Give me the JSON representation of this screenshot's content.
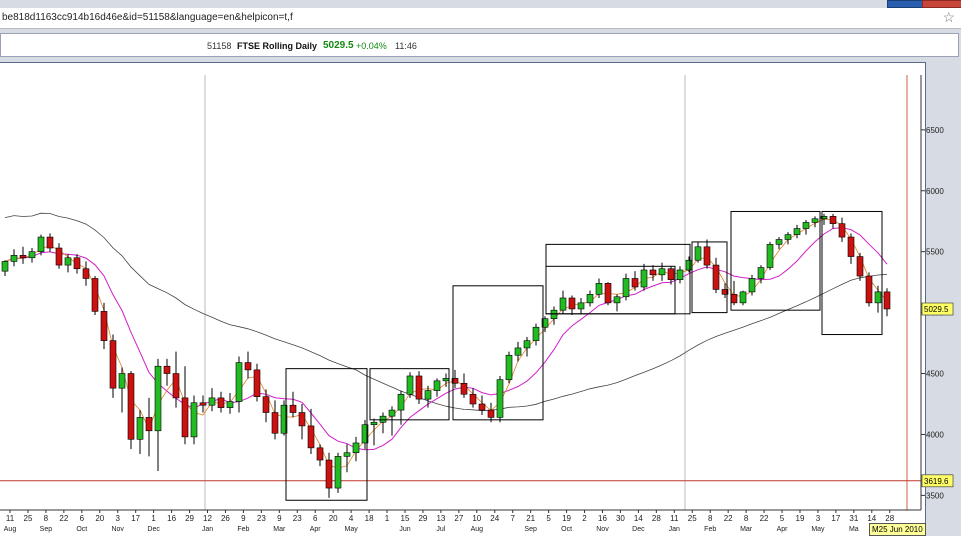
{
  "browser": {
    "url": "be818d1163cc914b16d46e&id=51158&language=en&helpicon=t,f"
  },
  "quote": {
    "id": "51158",
    "name": "FTSE Rolling Daily",
    "price": "5029.5",
    "change": "+0.04%",
    "time": "11:46"
  },
  "chart_data": {
    "type": "candlestick",
    "ylim": [
      3380,
      6950
    ],
    "y_ticks": [
      3500,
      4000,
      4500,
      5000,
      5500,
      6000,
      6500
    ],
    "price_marker": "5029.5",
    "level_marker": "3619.6",
    "reference_level": 3619.6,
    "date_badge": "M25 Jun 2010",
    "x_ticks": [
      {
        "day": "11",
        "month": "Aug"
      },
      {
        "day": "25",
        "month": ""
      },
      {
        "day": "8",
        "month": "Sep"
      },
      {
        "day": "22",
        "month": ""
      },
      {
        "day": "6",
        "month": "Oct"
      },
      {
        "day": "20",
        "month": ""
      },
      {
        "day": "3",
        "month": "Nov"
      },
      {
        "day": "17",
        "month": ""
      },
      {
        "day": "1",
        "month": "Dec"
      },
      {
        "day": "16",
        "month": ""
      },
      {
        "day": "29",
        "month": ""
      },
      {
        "day": "12",
        "month": "Jan"
      },
      {
        "day": "26",
        "month": ""
      },
      {
        "day": "9",
        "month": "Feb"
      },
      {
        "day": "23",
        "month": ""
      },
      {
        "day": "9",
        "month": "Mar"
      },
      {
        "day": "23",
        "month": ""
      },
      {
        "day": "6",
        "month": "Apr"
      },
      {
        "day": "20",
        "month": ""
      },
      {
        "day": "4",
        "month": "May"
      },
      {
        "day": "18",
        "month": ""
      },
      {
        "day": "1",
        "month": ""
      },
      {
        "day": "15",
        "month": "Jun"
      },
      {
        "day": "29",
        "month": ""
      },
      {
        "day": "13",
        "month": "Jul"
      },
      {
        "day": "27",
        "month": ""
      },
      {
        "day": "10",
        "month": "Aug"
      },
      {
        "day": "24",
        "month": ""
      },
      {
        "day": "7",
        "month": ""
      },
      {
        "day": "21",
        "month": "Sep"
      },
      {
        "day": "5",
        "month": ""
      },
      {
        "day": "19",
        "month": "Oct"
      },
      {
        "day": "2",
        "month": ""
      },
      {
        "day": "16",
        "month": "Nov"
      },
      {
        "day": "30",
        "month": ""
      },
      {
        "day": "14",
        "month": "Dec"
      },
      {
        "day": "28",
        "month": ""
      },
      {
        "day": "11",
        "month": "Jan"
      },
      {
        "day": "25",
        "month": ""
      },
      {
        "day": "8",
        "month": "Feb"
      },
      {
        "day": "22",
        "month": ""
      },
      {
        "day": "8",
        "month": "Mar"
      },
      {
        "day": "22",
        "month": ""
      },
      {
        "day": "5",
        "month": "Apr"
      },
      {
        "day": "19",
        "month": ""
      },
      {
        "day": "3",
        "month": "May"
      },
      {
        "day": "17",
        "month": ""
      },
      {
        "day": "31",
        "month": "Ma"
      },
      {
        "day": "14",
        "month": ""
      },
      {
        "day": "28",
        "month": ""
      }
    ],
    "candles": [
      [
        5340,
        5430,
        5300,
        5420
      ],
      [
        5420,
        5520,
        5380,
        5470
      ],
      [
        5470,
        5540,
        5400,
        5450
      ],
      [
        5450,
        5530,
        5410,
        5500
      ],
      [
        5500,
        5640,
        5470,
        5620
      ],
      [
        5620,
        5650,
        5500,
        5530
      ],
      [
        5530,
        5570,
        5360,
        5390
      ],
      [
        5390,
        5480,
        5330,
        5450
      ],
      [
        5450,
        5480,
        5320,
        5360
      ],
      [
        5360,
        5420,
        5220,
        5280
      ],
      [
        5280,
        5300,
        4980,
        5010
      ],
      [
        5010,
        5080,
        4700,
        4770
      ],
      [
        4770,
        4820,
        4300,
        4380
      ],
      [
        4380,
        4550,
        4180,
        4500
      ],
      [
        4500,
        4520,
        3880,
        3960
      ],
      [
        3960,
        4200,
        3840,
        4140
      ],
      [
        4140,
        4300,
        3820,
        4030
      ],
      [
        4030,
        4620,
        3700,
        4560
      ],
      [
        4560,
        4620,
        4400,
        4500
      ],
      [
        4500,
        4680,
        4220,
        4300
      ],
      [
        4300,
        4560,
        3920,
        3980
      ],
      [
        3980,
        4320,
        3920,
        4260
      ],
      [
        4260,
        4320,
        4180,
        4240
      ],
      [
        4240,
        4380,
        4190,
        4300
      ],
      [
        4300,
        4350,
        4180,
        4220
      ],
      [
        4220,
        4340,
        4170,
        4270
      ],
      [
        4270,
        4640,
        4180,
        4590
      ],
      [
        4590,
        4680,
        4460,
        4530
      ],
      [
        4530,
        4580,
        4270,
        4310
      ],
      [
        4310,
        4370,
        4100,
        4180
      ],
      [
        4180,
        4280,
        3960,
        4010
      ],
      [
        4010,
        4280,
        3990,
        4240
      ],
      [
        4240,
        4350,
        4140,
        4180
      ],
      [
        4180,
        4250,
        3960,
        4070
      ],
      [
        4070,
        4210,
        3840,
        3890
      ],
      [
        3890,
        3920,
        3740,
        3790
      ],
      [
        3790,
        3850,
        3480,
        3560
      ],
      [
        3560,
        3850,
        3520,
        3820
      ],
      [
        3820,
        3920,
        3690,
        3850
      ],
      [
        3850,
        3980,
        3780,
        3930
      ],
      [
        3930,
        4120,
        3880,
        4080
      ],
      [
        4080,
        4130,
        3910,
        4100
      ],
      [
        4100,
        4180,
        4010,
        4150
      ],
      [
        4150,
        4230,
        3990,
        4200
      ],
      [
        4200,
        4360,
        4080,
        4330
      ],
      [
        4330,
        4510,
        4300,
        4480
      ],
      [
        4480,
        4520,
        4250,
        4290
      ],
      [
        4290,
        4400,
        4220,
        4360
      ],
      [
        4360,
        4460,
        4310,
        4440
      ],
      [
        4440,
        4500,
        4390,
        4460
      ],
      [
        4460,
        4530,
        4380,
        4420
      ],
      [
        4420,
        4500,
        4300,
        4330
      ],
      [
        4330,
        4380,
        4220,
        4250
      ],
      [
        4250,
        4320,
        4160,
        4200
      ],
      [
        4200,
        4260,
        4100,
        4140
      ],
      [
        4140,
        4480,
        4100,
        4450
      ],
      [
        4450,
        4680,
        4420,
        4650
      ],
      [
        4650,
        4760,
        4600,
        4710
      ],
      [
        4710,
        4800,
        4640,
        4770
      ],
      [
        4770,
        4910,
        4730,
        4880
      ],
      [
        4880,
        4970,
        4840,
        4950
      ],
      [
        4950,
        5050,
        4900,
        5020
      ],
      [
        5020,
        5180,
        4990,
        5120
      ],
      [
        5120,
        5140,
        4980,
        5030
      ],
      [
        5030,
        5120,
        4990,
        5080
      ],
      [
        5080,
        5180,
        5050,
        5150
      ],
      [
        5150,
        5280,
        5120,
        5240
      ],
      [
        5240,
        5250,
        5060,
        5080
      ],
      [
        5080,
        5150,
        5010,
        5130
      ],
      [
        5130,
        5320,
        5100,
        5280
      ],
      [
        5280,
        5340,
        5180,
        5210
      ],
      [
        5210,
        5400,
        5180,
        5350
      ],
      [
        5350,
        5390,
        5260,
        5310
      ],
      [
        5310,
        5410,
        5260,
        5360
      ],
      [
        5360,
        5380,
        5230,
        5270
      ],
      [
        5270,
        5380,
        5240,
        5350
      ],
      [
        5350,
        5460,
        5330,
        5430
      ],
      [
        5430,
        5580,
        5410,
        5540
      ],
      [
        5540,
        5600,
        5360,
        5390
      ],
      [
        5390,
        5450,
        5160,
        5190
      ],
      [
        5190,
        5240,
        5120,
        5150
      ],
      [
        5150,
        5260,
        5060,
        5080
      ],
      [
        5080,
        5180,
        5060,
        5170
      ],
      [
        5170,
        5310,
        5140,
        5280
      ],
      [
        5280,
        5390,
        5240,
        5370
      ],
      [
        5370,
        5580,
        5350,
        5560
      ],
      [
        5560,
        5620,
        5520,
        5600
      ],
      [
        5600,
        5660,
        5560,
        5640
      ],
      [
        5640,
        5720,
        5610,
        5690
      ],
      [
        5690,
        5760,
        5640,
        5740
      ],
      [
        5740,
        5790,
        5700,
        5770
      ],
      [
        5770,
        5810,
        5720,
        5790
      ],
      [
        5790,
        5810,
        5690,
        5730
      ],
      [
        5730,
        5780,
        5580,
        5620
      ],
      [
        5620,
        5650,
        5400,
        5460
      ],
      [
        5460,
        5490,
        5260,
        5300
      ],
      [
        5300,
        5330,
        5050,
        5080
      ],
      [
        5080,
        5220,
        5000,
        5170
      ],
      [
        5170,
        5200,
        4970,
        5030
      ]
    ],
    "boxes": [
      {
        "x0": 286,
        "x1": 367,
        "hi": 4540,
        "lo": 3460
      },
      {
        "x0": 370,
        "x1": 449,
        "hi": 4540,
        "lo": 4120
      },
      {
        "x0": 453,
        "x1": 543,
        "hi": 5220,
        "lo": 4120
      },
      {
        "x0": 546,
        "x1": 690,
        "hi": 5560,
        "lo": 4990
      },
      {
        "x0": 546,
        "x1": 675,
        "hi": 5380,
        "lo": 4990
      },
      {
        "x0": 692,
        "x1": 727,
        "hi": 5580,
        "lo": 5000
      },
      {
        "x0": 731,
        "x1": 820,
        "hi": 5830,
        "lo": 5020
      },
      {
        "x0": 822,
        "x1": 882,
        "hi": 5830,
        "lo": 4820
      }
    ]
  }
}
